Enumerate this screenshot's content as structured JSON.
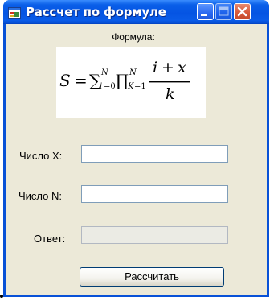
{
  "window": {
    "title": "Рассчет по формуле",
    "icon": "app-icon",
    "controls": [
      "minimize-icon",
      "maximize-icon",
      "close-icon"
    ]
  },
  "formula": {
    "label": "Формула:",
    "expression": "S = Σ_{i=0}^{N} Π_{K=1}^{N} (i + x) / k"
  },
  "fields": {
    "x_label": "Число X:",
    "x_value": "",
    "n_label": "Число N:",
    "n_value": "",
    "answer_label": "Ответ:",
    "answer_value": ""
  },
  "actions": {
    "calculate_label": "Рассчитать"
  },
  "colors": {
    "titlebar": "#0554e3",
    "window_bg": "#ece9d8",
    "close_button": "#d85a3a"
  }
}
